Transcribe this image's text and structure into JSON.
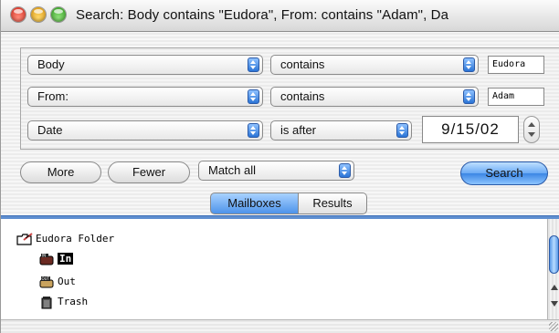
{
  "window": {
    "title": "Search: Body contains \"Eudora\", From: contains \"Adam\", Da"
  },
  "criteria": [
    {
      "field": "Body",
      "operator": "contains",
      "value": "Eudora"
    },
    {
      "field": "From:",
      "operator": "contains",
      "value": "Adam"
    },
    {
      "field": "Date",
      "operator": "is after",
      "value": "9/15/02"
    }
  ],
  "buttons": {
    "more": "More",
    "fewer": "Fewer",
    "match": "Match all",
    "search": "Search"
  },
  "tabs": [
    {
      "label": "Mailboxes",
      "active": true
    },
    {
      "label": "Results",
      "active": false
    }
  ],
  "mailboxes": {
    "folder": "Eudora Folder",
    "items": [
      {
        "label": "In",
        "selected": true
      },
      {
        "label": "Out",
        "selected": false
      },
      {
        "label": "Trash",
        "selected": false
      }
    ]
  },
  "colors": {
    "accent": "#4d93ea",
    "tab_line": "#5f8fd0"
  }
}
